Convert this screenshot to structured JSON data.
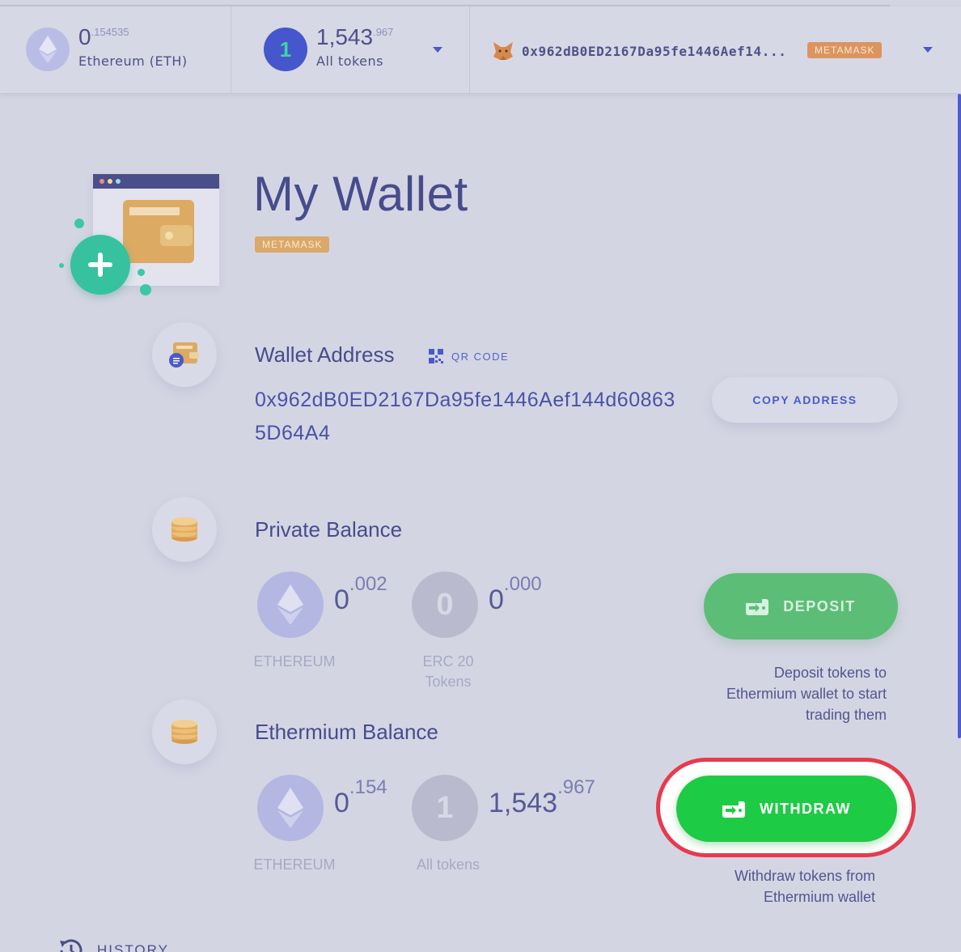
{
  "topbar": {
    "eth": {
      "whole": "0",
      "decimals": ".154535",
      "label": "Ethereum (ETH)"
    },
    "tokens": {
      "count": "1",
      "whole": "1,543",
      "decimals": ".967",
      "label": "All tokens"
    },
    "account": {
      "address": "0x962dB0ED2167Da95fe1446Aef14...",
      "badge": "METAMASK"
    }
  },
  "wallet": {
    "title": "My Wallet",
    "badge": "METAMASK"
  },
  "address_section": {
    "title": "Wallet Address",
    "qr_label": "QR CODE",
    "address": "0x962dB0ED2167Da95fe1446Aef144d608635D64A4",
    "copy_label": "COPY ADDRESS"
  },
  "private_balance": {
    "title": "Private Balance",
    "eth": {
      "whole": "0",
      "decimals": ".002",
      "label": "ETHEREUM"
    },
    "erc20": {
      "glyph": "0",
      "whole": "0",
      "decimals": ".000",
      "label_line1": "ERC 20",
      "label_line2": "Tokens"
    },
    "deposit_label": "DEPOSIT",
    "deposit_help_1": "Deposit tokens to",
    "deposit_help_2": "Ethermium wallet to start",
    "deposit_help_3": "trading them"
  },
  "ethermium_balance": {
    "title": "Ethermium Balance",
    "eth": {
      "whole": "0",
      "decimals": ".154",
      "label": "ETHEREUM"
    },
    "tokens": {
      "glyph": "1",
      "whole": "1,543",
      "decimals": ".967",
      "label": "All tokens"
    },
    "withdraw_label": "WITHDRAW",
    "withdraw_help_1": "Withdraw tokens from",
    "withdraw_help_2": "Ethermium wallet"
  },
  "history_label": "HISTORY",
  "colors": {
    "accent": "#4d5bd0",
    "withdraw": "#1ecb45",
    "deposit": "#5cbd77",
    "highlight_ring": "#e53b4d",
    "badge": "#d9a86a"
  },
  "icons": [
    "ethereum-icon",
    "token-count-icon",
    "metamask-fox-icon",
    "caret-down-icon",
    "wallet-illustration",
    "qr-code-icon",
    "coin-stack-icon",
    "wallet-arrow-icon",
    "history-icon"
  ]
}
